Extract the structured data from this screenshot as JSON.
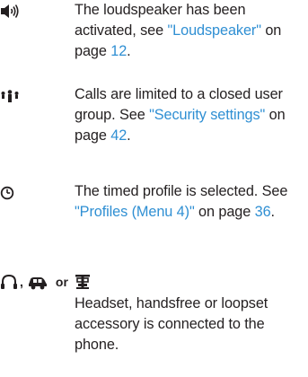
{
  "entries": [
    {
      "icon": "loudspeaker-icon",
      "text_before": "The loudspeaker has been activated, see ",
      "link": "\"Loudspeaker\"",
      "text_after": " on page ",
      "page": "12",
      "end": "."
    },
    {
      "icon": "closed-user-group-icon",
      "text_before": "Calls are limited to a closed user group. See ",
      "link": "\"Security settings\"",
      "text_after": " on page ",
      "page": "42",
      "end": "."
    },
    {
      "icon": "timed-profile-clock-icon",
      "text_before": "The timed profile is selected. See ",
      "link": "\"Profiles (Menu 4)\"",
      "text_after": " on page ",
      "page": "36",
      "end": "."
    }
  ],
  "accessory": {
    "icons": [
      "headset-icon",
      "handsfree-icon",
      "loopset-icon"
    ],
    "separator": ",",
    "or_word": "or",
    "text": "Headset, handsfree or loopset accessory is connected to the phone."
  },
  "colors": {
    "text": "#231f20",
    "link": "#2f8fd3"
  }
}
